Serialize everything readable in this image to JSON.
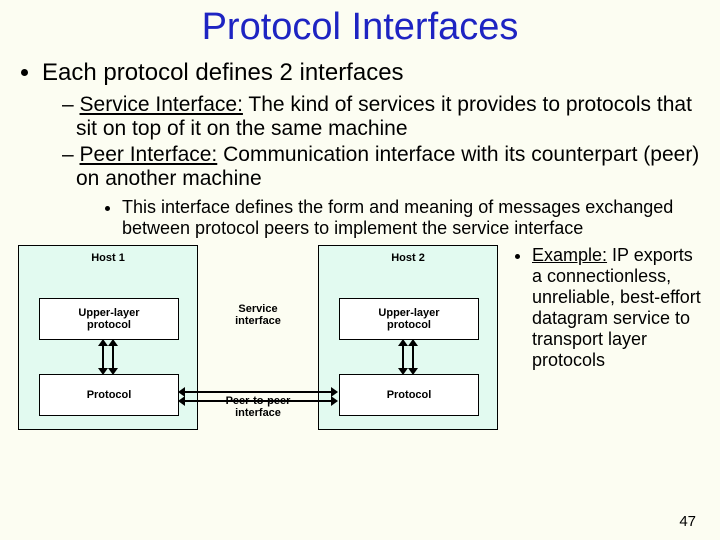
{
  "title": "Protocol Interfaces",
  "bullet_main": "Each protocol defines 2 interfaces",
  "sub1_label": "Service Interface:",
  "sub1_rest": " The kind of services it provides to protocols that sit on top of it on the same machine",
  "sub2_label": "Peer Interface:",
  "sub2_rest": " Communication interface with its counterpart (peer) on another machine",
  "subsub": "This interface defines the form and meaning of messages exchanged between protocol peers to implement the service interface",
  "example_label": "Example:",
  "example_rest": " IP exports a connectionless, unreliable, best-effort datagram service to transport layer protocols",
  "diagram": {
    "host1": "Host 1",
    "host2": "Host 2",
    "upper": "Upper-layer\nprotocol",
    "lower": "Protocol",
    "service_label": "Service\ninterface",
    "peer_label": "Peer-to-peer\ninterface"
  },
  "page": "47"
}
